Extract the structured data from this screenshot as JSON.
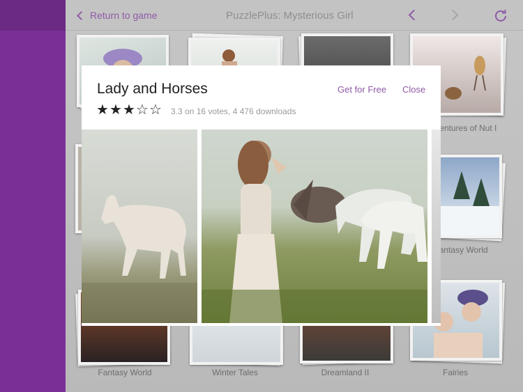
{
  "header": {
    "back_label": "Return to game",
    "title": "PuzzlePlus: Mysterious Girl"
  },
  "gallery": {
    "captions": {
      "nut": "Adventures of Nut I",
      "fantasy_world_right": "Fantasy World",
      "fantasy_world": "Fantasy World",
      "winter_tales": "Winter Tales",
      "dreamland": "Dreamland II",
      "fairies": "Fairies"
    }
  },
  "modal": {
    "title": "Lady and Horses",
    "get_label": "Get for Free",
    "close_label": "Close",
    "stars": [
      "★",
      "★",
      "★",
      "☆",
      "☆"
    ],
    "rating_value": 3.3,
    "rating_text": "3.3 on 16 votes, 4 476 downloads"
  },
  "colors": {
    "accent": "#8e5aa6",
    "sidebar": "#7a2f97"
  }
}
